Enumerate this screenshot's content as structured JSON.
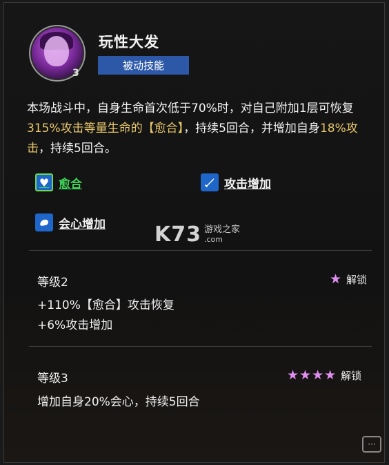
{
  "skill": {
    "name": "玩性大发",
    "type": "被动技能",
    "level_badge": "3",
    "description_parts": [
      "本场战斗中，自身生命首次低于70%时，对自己附加1层可恢复",
      "315%攻击等量生命的【愈合】",
      "，持续5回合，并增加自身",
      "18%攻击",
      "，持续5回合。"
    ],
    "highlight_color": "#e8c86c"
  },
  "effects": {
    "heal": {
      "label": "愈合",
      "icon": "heart-icon"
    },
    "attack": {
      "label": "攻击增加",
      "icon": "sword-icon"
    },
    "crit": {
      "label": "会心增加",
      "icon": "fist-icon"
    }
  },
  "levels": [
    {
      "title": "等级2",
      "stars": "★",
      "unlock_label": "解锁",
      "lines": [
        "+110%【愈合】攻击恢复",
        "+6%攻击增加"
      ]
    },
    {
      "title": "等级3",
      "stars": "★★★★",
      "unlock_label": "解锁",
      "lines": [
        "增加自身20%会心，持续5回合"
      ]
    }
  ],
  "watermark": {
    "brand": "K73",
    "line1": "游戏之家",
    "line2": ".com"
  }
}
